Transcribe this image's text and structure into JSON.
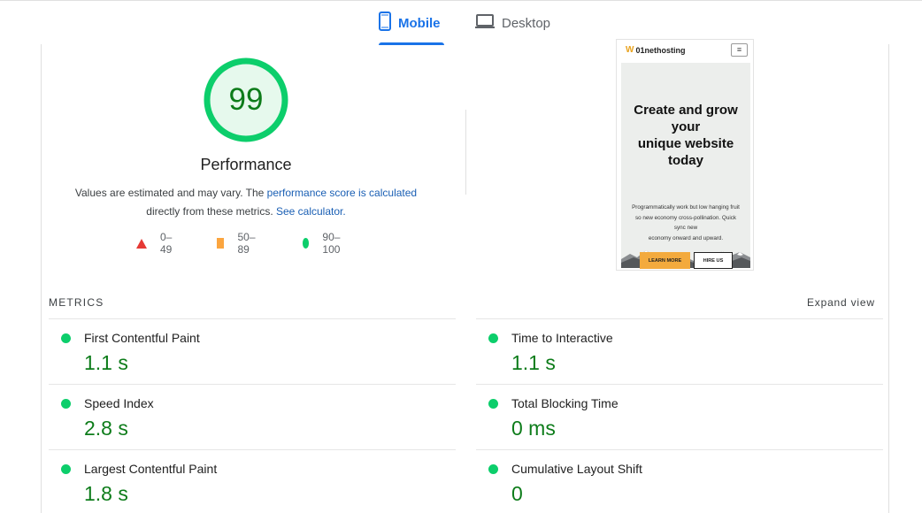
{
  "tabs": [
    {
      "label": "Mobile",
      "icon": "smartphone-icon",
      "active": true
    },
    {
      "label": "Desktop",
      "icon": "desktop-icon",
      "active": false
    }
  ],
  "score": {
    "value": "99",
    "label": "Performance",
    "color": "#0cce6b",
    "text_color": "#0d7c1a"
  },
  "description": {
    "part1": "Values are estimated and may vary. The ",
    "link1": "performance score is calculated",
    "part2": "directly from these metrics. ",
    "link2": "See calculator."
  },
  "legend": [
    {
      "range": "0–49",
      "shape": "triangle",
      "color": "#e53935"
    },
    {
      "range": "50–89",
      "shape": "square",
      "color": "#fba53f"
    },
    {
      "range": "90–100",
      "shape": "circle",
      "color": "#0cce6b"
    }
  ],
  "screenshot": {
    "logo": "01nethosting",
    "menu_icon": "≡",
    "title_lines": [
      "Create and grow",
      "your",
      "unique website",
      "today"
    ],
    "text_lines": [
      "Programmatically work but low hanging fruit",
      "so new economy cross-pollination. Quick",
      "sync new",
      "economy onward and upward."
    ],
    "button_primary": "LEARN MORE",
    "button_secondary": "HIRE US"
  },
  "metrics_section": {
    "title": "METRICS",
    "expand_label": "Expand view"
  },
  "metrics": [
    {
      "name": "First Contentful Paint",
      "value": "1.1 s",
      "status": "good"
    },
    {
      "name": "Time to Interactive",
      "value": "1.1 s",
      "status": "good"
    },
    {
      "name": "Speed Index",
      "value": "2.8 s",
      "status": "good"
    },
    {
      "name": "Total Blocking Time",
      "value": "0 ms",
      "status": "good"
    },
    {
      "name": "Largest Contentful Paint",
      "value": "1.8 s",
      "status": "good"
    },
    {
      "name": "Cumulative Layout Shift",
      "value": "0",
      "status": "good"
    }
  ]
}
